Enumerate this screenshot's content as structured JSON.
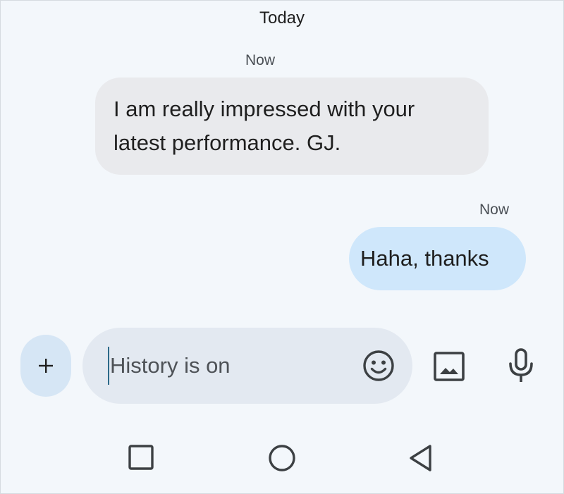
{
  "conversation": {
    "date_header": "Today",
    "messages": [
      {
        "direction": "incoming",
        "timestamp": "Now",
        "text_line1": "I am really impressed with your",
        "text_line2": "latest performance. GJ."
      },
      {
        "direction": "outgoing",
        "timestamp": "Now",
        "text": "Haha, thanks"
      }
    ]
  },
  "compose": {
    "add_icon": "plus-icon",
    "placeholder": "History is on",
    "emoji_icon": "emoji-icon",
    "gallery_icon": "image-icon",
    "voice_icon": "microphone-icon"
  },
  "navigation": {
    "recents_icon": "square-icon",
    "home_icon": "circle-icon",
    "back_icon": "triangle-back-icon"
  },
  "colors": {
    "background": "#f3f7fb",
    "incoming_bubble": "#e9eaed",
    "outgoing_bubble": "#cfe7fb",
    "compose_field": "#e3e9f1",
    "add_button": "#d6e6f5",
    "caret": "#2d6a89"
  }
}
